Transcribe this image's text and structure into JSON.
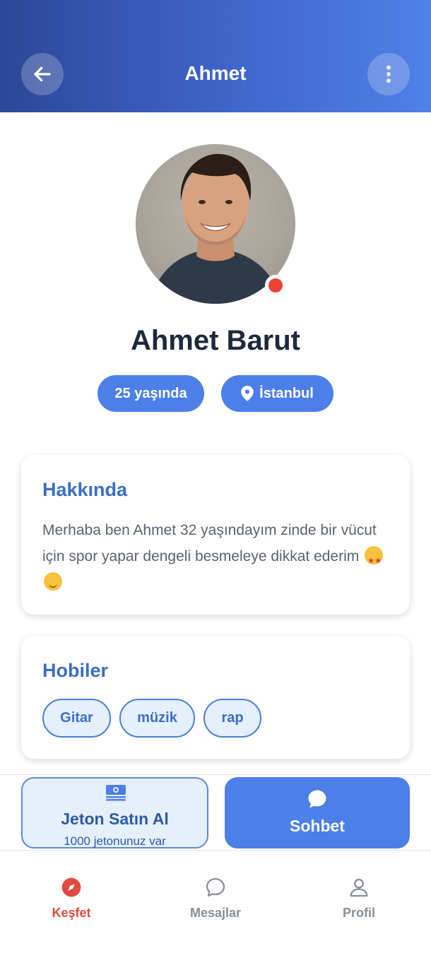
{
  "header": {
    "title": "Ahmet",
    "back_icon": "arrow-left-icon",
    "more_icon": "more-vertical-icon"
  },
  "profile": {
    "online_status": "online",
    "full_name": "Ahmet Barut",
    "age_label": "25 yaşında",
    "location_label": "İstanbul"
  },
  "about": {
    "title": "Hakkında",
    "text": "Merhaba ben Ahmet 32 yaşındayım zinde bir vücut için spor yapar dengeli besmeleye dikkat ederim",
    "emojis": [
      "star-struck-emoji",
      "hugging-face-emoji"
    ]
  },
  "hobbies": {
    "title": "Hobiler",
    "items": [
      "Gitar",
      "müzik",
      "rap"
    ]
  },
  "actions": {
    "buy": {
      "title": "Jeton Satın Al",
      "subtitle": "1000 jetonunuz var",
      "icon": "money-icon"
    },
    "chat": {
      "label": "Sohbet",
      "icon": "chat-bubble-icon"
    }
  },
  "bottom_nav": {
    "items": [
      {
        "label": "Keşfet",
        "icon": "compass-icon",
        "active": true
      },
      {
        "label": "Mesajlar",
        "icon": "chat-bubble-icon",
        "active": false
      },
      {
        "label": "Profil",
        "icon": "user-icon",
        "active": false
      }
    ]
  },
  "colors": {
    "header_gradient_start": "#2c4797",
    "header_gradient_end": "#4f81e8",
    "accent": "#4d7fe8",
    "title_blue": "#3a6fc4",
    "active_nav": "#e04a3f",
    "inactive_nav": "#8a8f98",
    "status_online": "#ea4335"
  }
}
